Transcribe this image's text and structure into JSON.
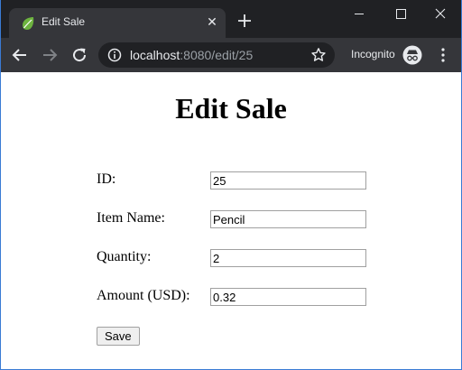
{
  "browser": {
    "tab": {
      "title": "Edit Sale",
      "favicon": "spring-leaf-icon",
      "close_symbol": "✕"
    },
    "new_tab_icon": "plus-icon",
    "window_controls": [
      "minimize-icon",
      "maximize-icon",
      "close-icon"
    ],
    "address_bar": {
      "host": "localhost",
      "rest": ":8080/edit/25",
      "info_icon": "info-icon",
      "bookmark_icon": "star-icon"
    },
    "incognito_label": "Incognito",
    "colors": {
      "frame": "#202124",
      "tab_active": "#35363a",
      "text": "#e8eaed",
      "text_dim": "#9aa0a6",
      "favicon": "#6db33f"
    }
  },
  "page": {
    "title": "Edit Sale",
    "fields": [
      {
        "label": "ID:",
        "value": "25"
      },
      {
        "label": "Item Name:",
        "value": "Pencil"
      },
      {
        "label": "Quantity:",
        "value": "2"
      },
      {
        "label": "Amount (USD):",
        "value": "0.32"
      }
    ],
    "save_label": "Save"
  }
}
